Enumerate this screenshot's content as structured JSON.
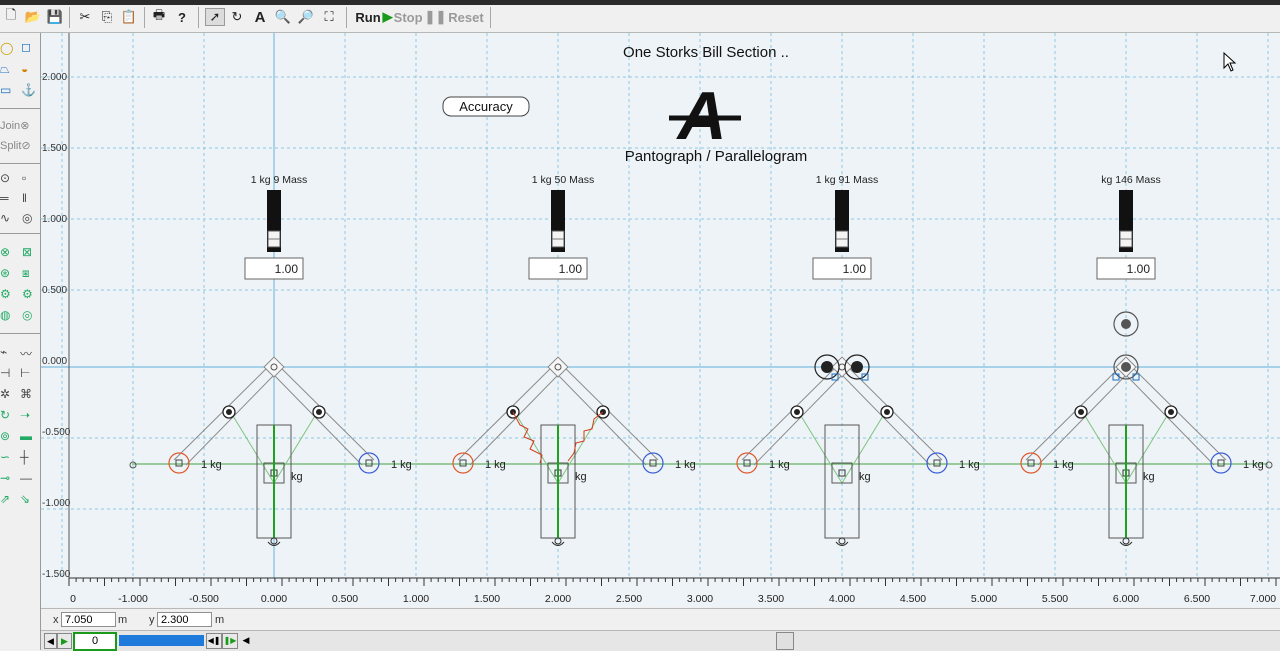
{
  "toolbar": {
    "run_label": "Run",
    "stop_label": "Stop",
    "reset_label": "Reset"
  },
  "palette": {
    "join_label": "Join",
    "split_label": "Split"
  },
  "canvas": {
    "title": "One Storks Bill Section ..",
    "subtitle": "Pantograph / Parallelogram",
    "accuracy_button": "Accuracy",
    "y_ticks": [
      "2.000",
      "1.500",
      "1.000",
      "0.500",
      "0.000",
      "-0.500",
      "-1.000",
      "-1.500"
    ],
    "x_ticks": [
      "0",
      "-1.000",
      "-0.500",
      "0.000",
      "0.500",
      "1.000",
      "1.500",
      "2.000",
      "2.500",
      "3.000",
      "3.500",
      "4.000",
      "4.500",
      "5.000",
      "5.500",
      "6.000",
      "6.500",
      "7.000"
    ],
    "sections": [
      {
        "mass_label": "1 kg 9 Mass",
        "value": "1.00"
      },
      {
        "mass_label": "1 kg 50 Mass",
        "value": "1.00"
      },
      {
        "mass_label": "1 kg 91 Mass",
        "value": "1.00"
      },
      {
        "mass_label": "kg 146 Mass",
        "value": "1.00"
      }
    ],
    "kg_label": "1 kg",
    "center_kg_label": "kg"
  },
  "status": {
    "x_label": "x",
    "x_value": "7.050",
    "x_unit": "m",
    "y_label": "y",
    "y_value": "2.300",
    "y_unit": "m"
  },
  "playback": {
    "frame": "0"
  }
}
